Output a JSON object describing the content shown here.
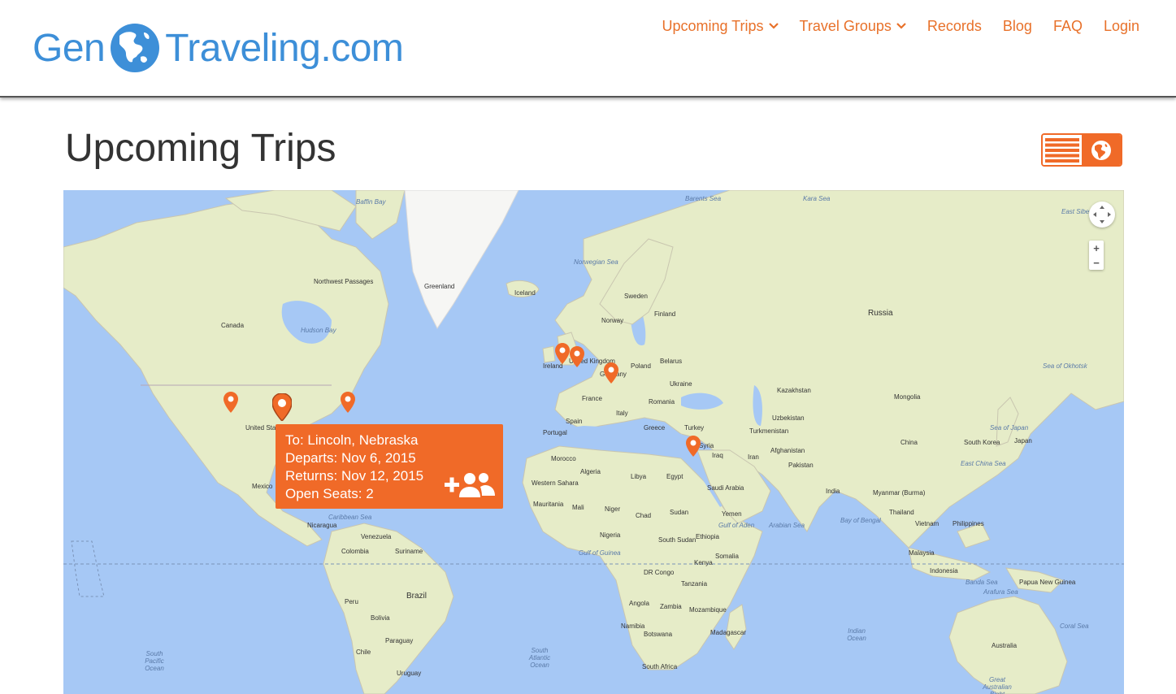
{
  "brand": {
    "left": "Gen",
    "right": "Traveling.com",
    "color": "#3d8fd8"
  },
  "nav": {
    "items": [
      {
        "label": "Upcoming Trips",
        "dropdown": true
      },
      {
        "label": "Travel Groups",
        "dropdown": true
      },
      {
        "label": "Records",
        "dropdown": false
      },
      {
        "label": "Blog",
        "dropdown": false
      },
      {
        "label": "FAQ",
        "dropdown": false
      },
      {
        "label": "Login",
        "dropdown": false
      }
    ],
    "color": "#e8712a"
  },
  "page": {
    "title": "Upcoming Trips"
  },
  "view_toggle": {
    "icons": [
      "list-icon",
      "globe-icon"
    ],
    "active": "map",
    "accent": "#f06a28"
  },
  "map": {
    "labels": {
      "baffin_bay": "Baffin Bay",
      "barents_sea": "Barents Sea",
      "kara_sea": "Kara Sea",
      "east_siberian": "East Siberian",
      "northwest_passages": "Northwest Passages",
      "greenland": "Greenland",
      "norwegian_sea": "Norwegian Sea",
      "iceland": "Iceland",
      "sweden": "Sweden",
      "finland": "Finland",
      "norway": "Norway",
      "russia": "Russia",
      "canada": "Canada",
      "hudson_bay": "Hudson Bay",
      "united_kingdom": "United Kingdom",
      "ireland": "Ireland",
      "poland": "Poland",
      "belarus": "Belarus",
      "germany": "Germany",
      "ukraine": "Ukraine",
      "france": "France",
      "romania": "Romania",
      "kazakhstan": "Kazakhstan",
      "mongolia": "Mongolia",
      "sea_of_okhotsk": "Sea of Okhotsk",
      "spain": "Spain",
      "italy": "Italy",
      "portugal": "Portugal",
      "greece": "Greece",
      "turkey": "Turkey",
      "uzbekistan": "Uzbekistan",
      "turkmenistan": "Turkmenistan",
      "syria": "Syria",
      "iraq": "Iraq",
      "iran": "Iran",
      "afghanistan": "Afghanistan",
      "pakistan": "Pakistan",
      "china": "China",
      "south_korea": "South Korea",
      "japan": "Japan",
      "sea_of_japan": "Sea of Japan",
      "east_china_sea": "East China Sea",
      "morocco": "Morocco",
      "algeria": "Algeria",
      "libya": "Libya",
      "egypt": "Egypt",
      "saudi_arabia": "Saudi Arabia",
      "india": "India",
      "myanmar": "Myanmar (Burma)",
      "thailand": "Thailand",
      "vietnam": "Vietnam",
      "philippines": "Philippines",
      "mexico": "Mexico",
      "united_states": "United States",
      "western_sahara": "Western Sahara",
      "mauritania": "Mauritania",
      "mali": "Mali",
      "niger": "Niger",
      "chad": "Chad",
      "sudan": "Sudan",
      "yemen": "Yemen",
      "arabian_sea": "Arabian Sea",
      "bay_of_bengal": "Bay of Bengal",
      "caribbean_sea": "Caribbean Sea",
      "nicaragua": "Nicaragua",
      "venezuela": "Venezuela",
      "colombia": "Colombia",
      "suriname": "Suriname",
      "nigeria": "Nigeria",
      "south_sudan": "South Sudan",
      "ethiopia": "Ethiopia",
      "somalia": "Somalia",
      "gulf_of_aden": "Gulf of Aden",
      "gulf_of_guinea": "Gulf of Guinea",
      "kenya": "Kenya",
      "malaysia": "Malaysia",
      "indonesia": "Indonesia",
      "papua_new_guinea": "Papua New Guinea",
      "peru": "Peru",
      "brazil": "Brazil",
      "dr_congo": "DR Congo",
      "tanzania": "Tanzania",
      "angola": "Angola",
      "zambia": "Zambia",
      "bolivia": "Bolivia",
      "mozambique": "Mozambique",
      "namibia": "Namibia",
      "madagascar": "Madagascar",
      "botswana": "Botswana",
      "paraguay": "Paraguay",
      "chile": "Chile",
      "south_africa": "South Africa",
      "south_pacific": "South Pacific Ocean",
      "south_atlantic": "South Atlantic Ocean",
      "indian_ocean": "Indian Ocean",
      "coral_sea": "Coral Sea",
      "australia": "Australia",
      "arafura_sea": "Arafura Sea",
      "banda_sea": "Banda Sea",
      "uruguay": "Uruguay",
      "great_australian_bight": "Great Australian Bight"
    },
    "pins": [
      {
        "name": "pin-wyoming"
      },
      {
        "name": "pin-lincoln-nebraska",
        "selected": true
      },
      {
        "name": "pin-new-york"
      },
      {
        "name": "pin-ireland"
      },
      {
        "name": "pin-england"
      },
      {
        "name": "pin-germany"
      },
      {
        "name": "pin-israel"
      }
    ],
    "pin_color": "#f06a28",
    "infobox": {
      "to": "To: Lincoln, Nebraska",
      "departs": "Departs: Nov 6, 2015",
      "returns": "Returns: Nov 12, 2015",
      "seats": "Open Seats: 2",
      "join_icon": "add-group-icon"
    },
    "controls": {
      "zoom_in": "+",
      "zoom_out": "−",
      "pan_icon": "pan-icon"
    }
  }
}
